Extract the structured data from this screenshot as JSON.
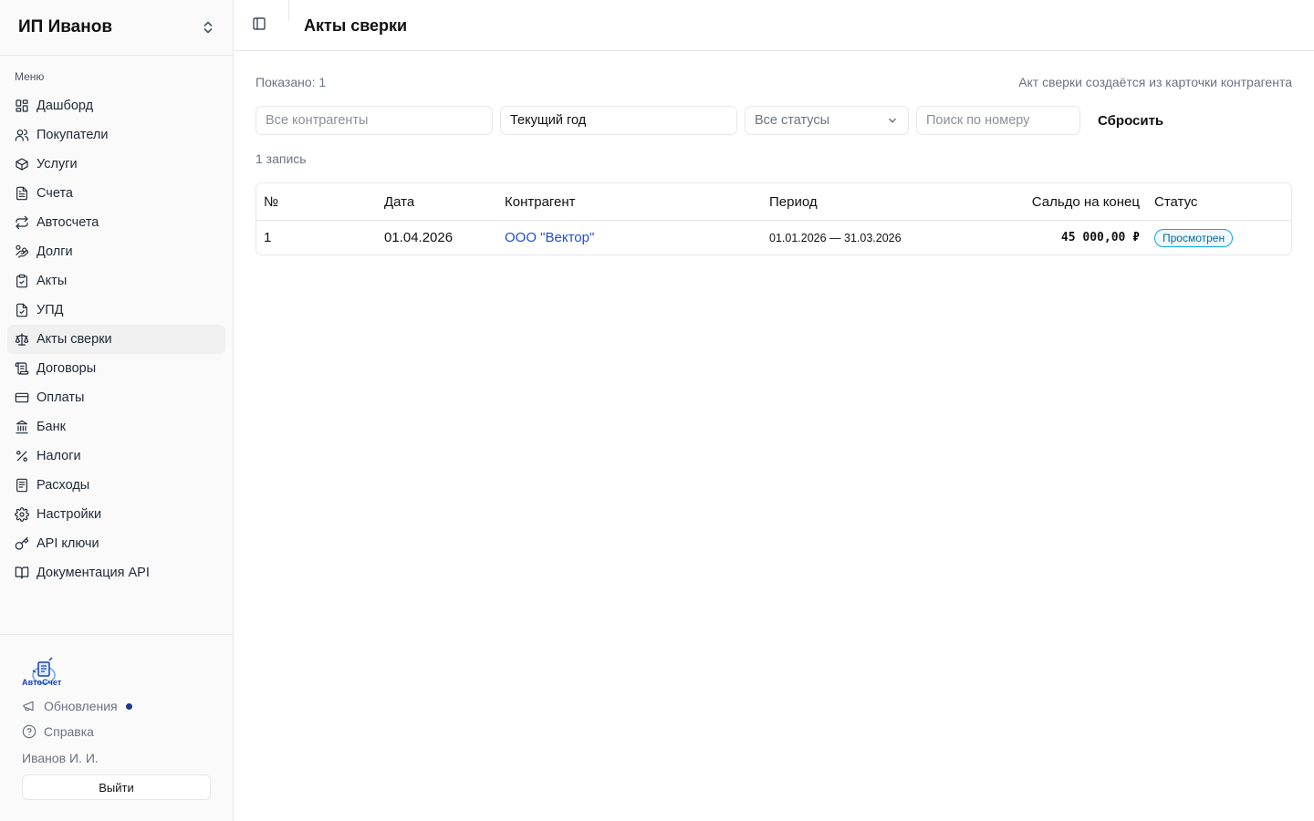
{
  "sidebar": {
    "org_name": "ИП Иванов",
    "menu_caption": "Меню",
    "items": [
      {
        "label": "Дашборд",
        "icon": "dashboard-icon"
      },
      {
        "label": "Покупатели",
        "icon": "users-icon"
      },
      {
        "label": "Услуги",
        "icon": "box-icon"
      },
      {
        "label": "Счета",
        "icon": "file-text-icon"
      },
      {
        "label": "Автосчета",
        "icon": "repeat-icon"
      },
      {
        "label": "Долги",
        "icon": "hand-coins-icon"
      },
      {
        "label": "Акты",
        "icon": "clipboard-check-icon"
      },
      {
        "label": "УПД",
        "icon": "file-check-icon"
      },
      {
        "label": "Акты сверки",
        "icon": "scale-icon",
        "active": true
      },
      {
        "label": "Договоры",
        "icon": "scroll-icon"
      },
      {
        "label": "Оплаты",
        "icon": "credit-card-icon"
      },
      {
        "label": "Банк",
        "icon": "bank-icon"
      },
      {
        "label": "Налоги",
        "icon": "percent-icon"
      },
      {
        "label": "Расходы",
        "icon": "receipt-icon"
      },
      {
        "label": "Настройки",
        "icon": "gear-icon"
      },
      {
        "label": "API ключи",
        "icon": "key-icon"
      },
      {
        "label": "Документация API",
        "icon": "book-icon"
      }
    ],
    "logo_text": "АвтоСчет",
    "updates_label": "Обновления",
    "help_label": "Справка",
    "user_name": "Иванов И. И.",
    "logout_label": "Выйти"
  },
  "header": {
    "title": "Акты сверки"
  },
  "summary": {
    "shown": "Показано: 1",
    "hint": "Акт сверки создаётся из карточки контрагента",
    "count": "1 запись"
  },
  "filters": {
    "counterparty_placeholder": "Все контрагенты",
    "period_value": "Текущий год",
    "status_value": "Все статусы",
    "search_placeholder": "Поиск по номеру",
    "reset_label": "Сбросить"
  },
  "table": {
    "columns": [
      "№",
      "Дата",
      "Контрагент",
      "Период",
      "Сальдо на конец",
      "Статус"
    ],
    "rows": [
      {
        "number": "1",
        "date": "01.04.2026",
        "counterparty": "ООО \"Вектор\"",
        "period": "01.01.2026 — 31.03.2026",
        "balance": "45 000,00 ₽",
        "status": "Просмотрен"
      }
    ]
  },
  "colors": {
    "link": "#1d4ed8",
    "status_badge": "#0ea5e9",
    "notification_dot": "#1e3a8a"
  }
}
